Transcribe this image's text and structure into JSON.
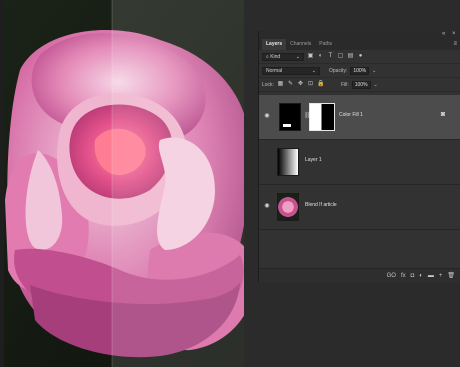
{
  "panel": {
    "top_controls": [
      "«",
      "×"
    ],
    "tabs": [
      {
        "label": "Layers",
        "active": true
      },
      {
        "label": "Channels",
        "active": false
      },
      {
        "label": "Paths",
        "active": false
      }
    ],
    "menu_icon": "hamburger-menu-icon",
    "filter": {
      "label": "Kind",
      "icons": [
        "pixel-filter-icon",
        "adjustment-filter-icon",
        "type-filter-icon",
        "shape-filter-icon",
        "smart-object-filter-icon",
        "filter-toggle-icon"
      ]
    },
    "blend_mode": "Normal",
    "opacity_label": "Opacity:",
    "opacity_value": "100%",
    "lock_label": "Lock:",
    "lock_icons": [
      "lock-transparent-icon",
      "lock-paint-icon",
      "lock-move-icon",
      "lock-artboard-icon",
      "lock-all-icon"
    ],
    "fill_label": "Fill:",
    "fill_value": "100%"
  },
  "layers": [
    {
      "name": "Color Fill 1",
      "visible": true,
      "selected": true
    },
    {
      "name": "Layer 1",
      "visible": false,
      "selected": false
    },
    {
      "name": "Blend If article",
      "visible": true,
      "selected": false
    }
  ],
  "footer_icons": [
    "link-layers-icon",
    "fx-icon",
    "add-mask-icon",
    "new-adjustment-icon",
    "new-group-icon",
    "new-layer-icon",
    "delete-icon"
  ],
  "footer_glyphs": [
    "GO",
    "fx",
    "◘",
    "◐",
    "▬",
    "+",
    "🗑"
  ],
  "colors": {
    "panel_bg": "#323232",
    "selected_row": "#4c4c4c",
    "rose_pink": "#d9679f",
    "background_dark": "#151a13"
  }
}
